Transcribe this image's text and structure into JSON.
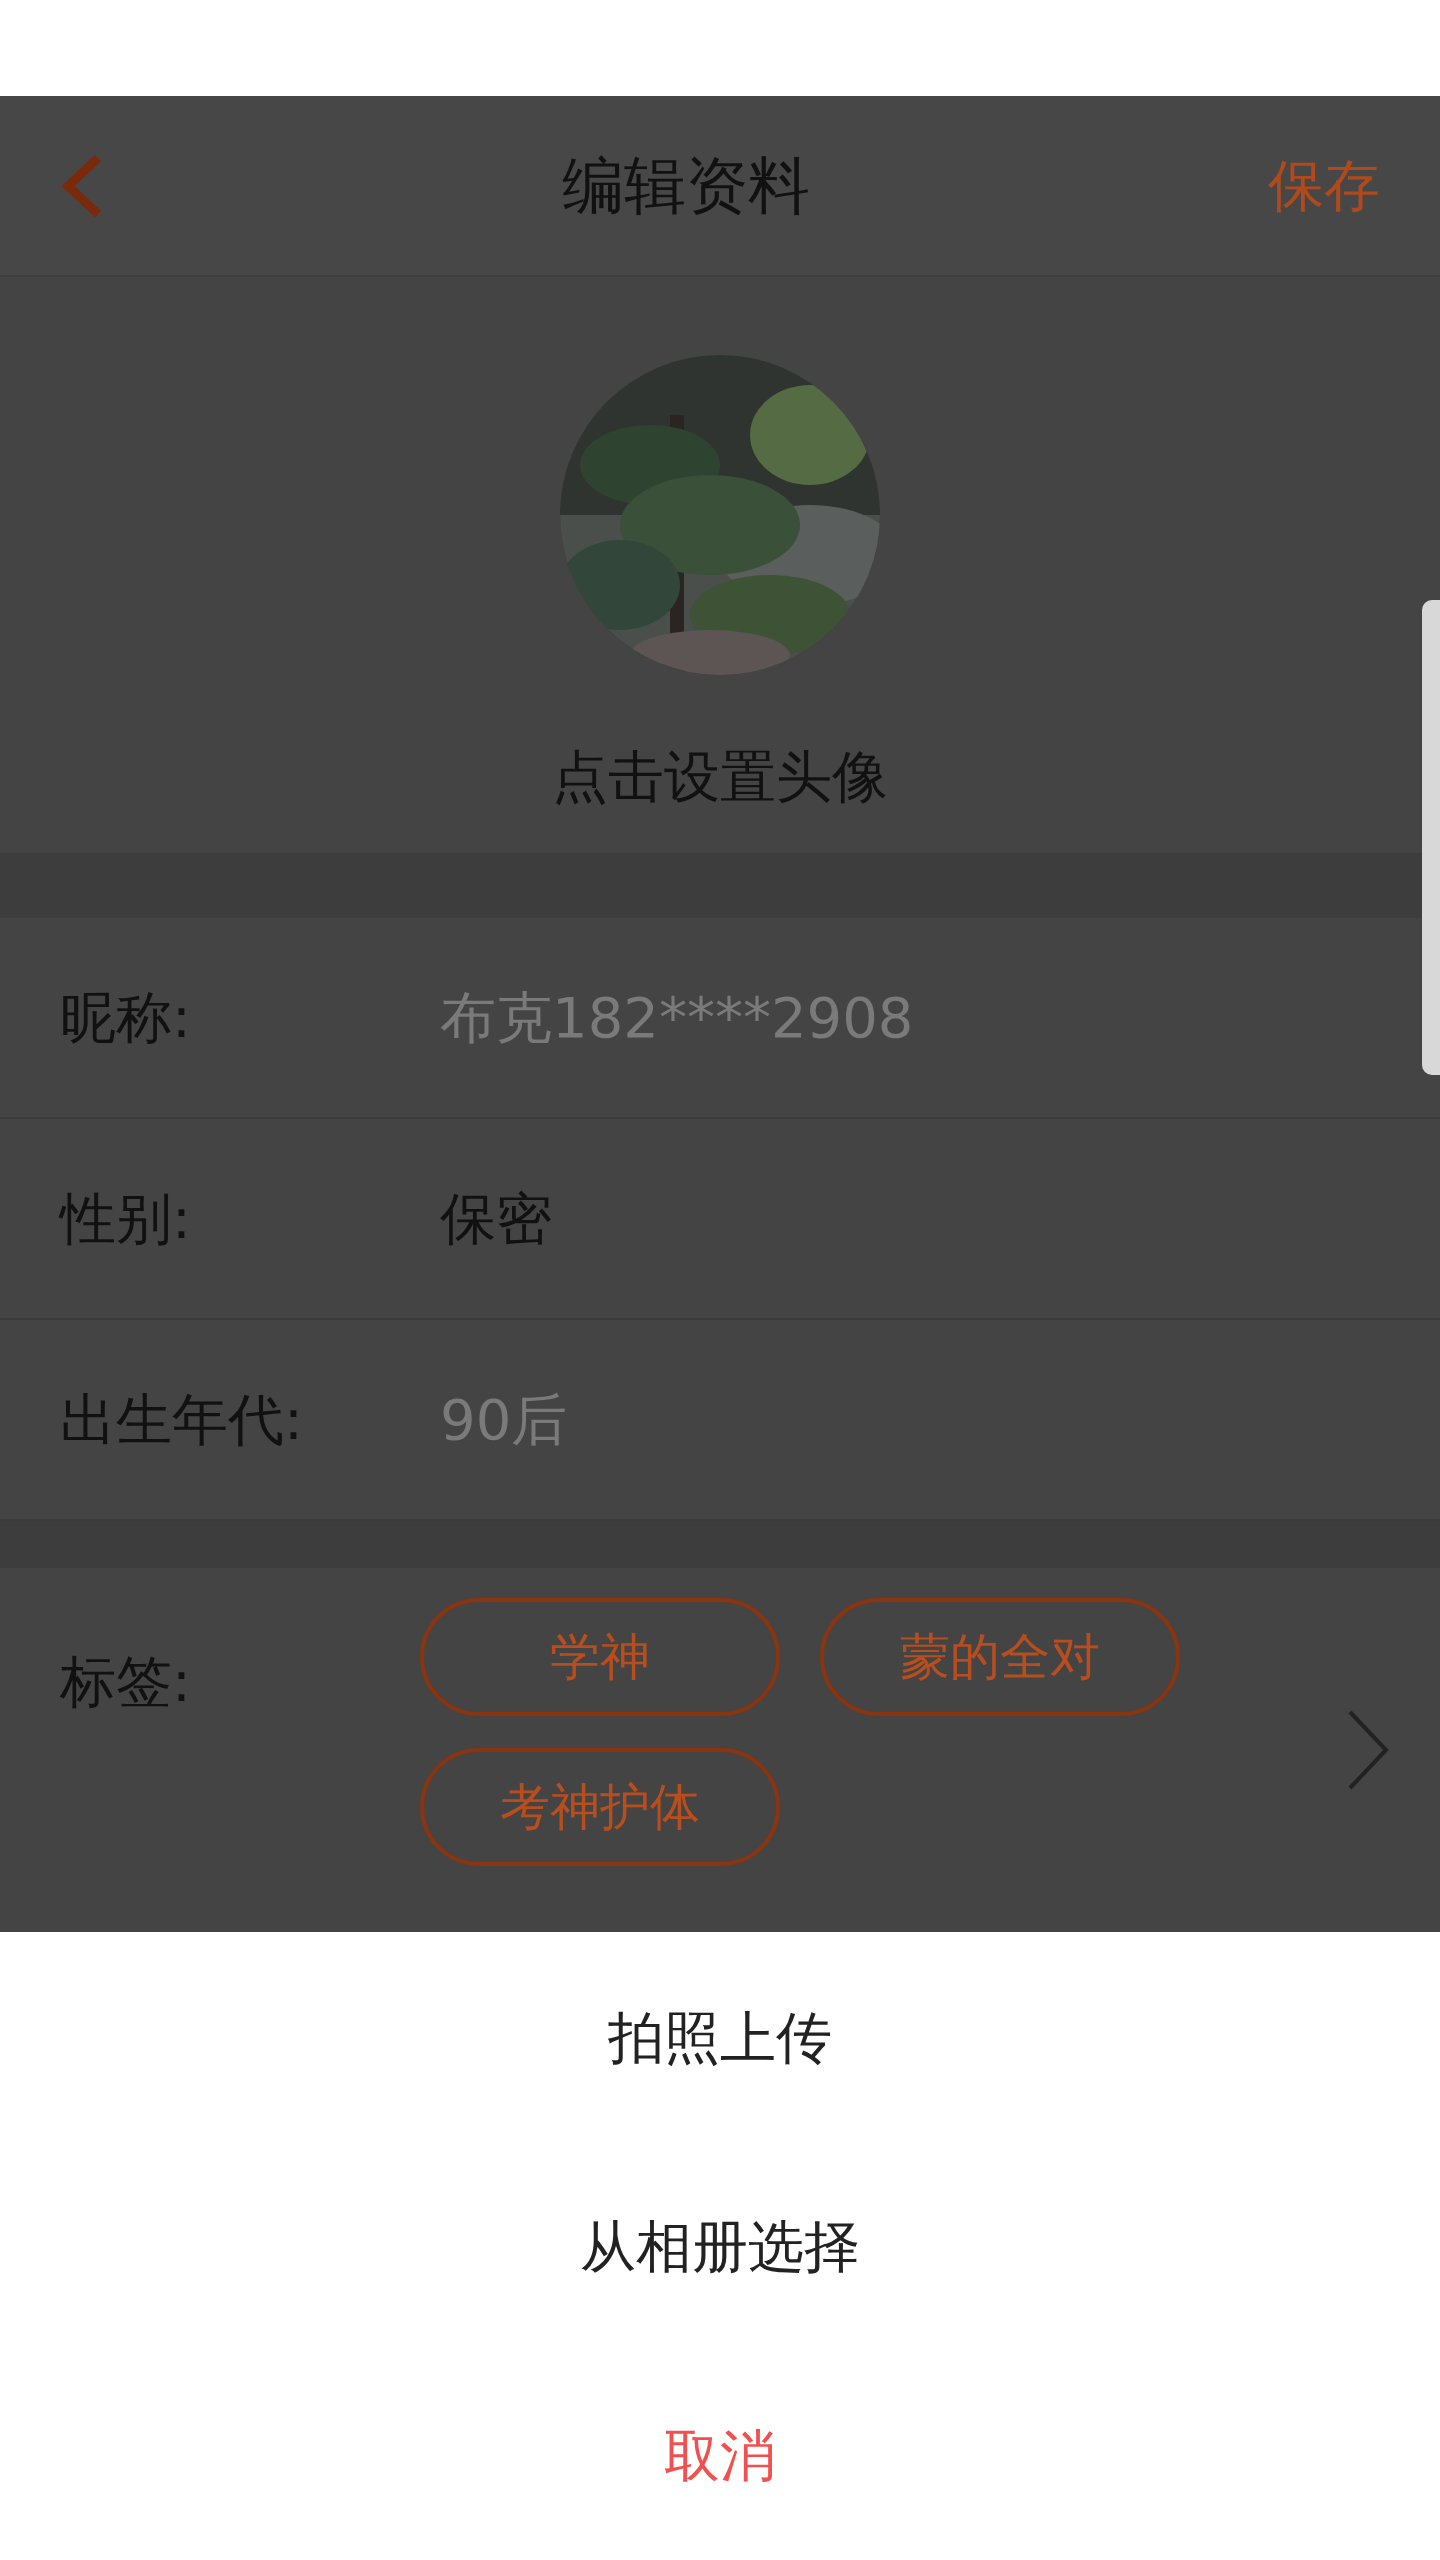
{
  "header": {
    "title": "编辑资料",
    "save": "保存"
  },
  "avatar": {
    "kind": "picture",
    "caption": "点击设置头像"
  },
  "fields": [
    {
      "label": "昵称:",
      "value": "布克182****2908",
      "dimmed": true
    },
    {
      "label": "性别:",
      "value": "保密",
      "dimmed": false
    },
    {
      "label": "出生年代:",
      "value": "90后",
      "dimmed": true
    }
  ],
  "tags": {
    "label": "标签:",
    "items": [
      "学神",
      "蒙的全对",
      "考神护体"
    ]
  },
  "sheet": {
    "options": [
      {
        "label": "拍照上传",
        "kind": "normal"
      },
      {
        "label": "从相册选择",
        "kind": "normal"
      },
      {
        "label": "取消",
        "kind": "cancel"
      }
    ]
  }
}
